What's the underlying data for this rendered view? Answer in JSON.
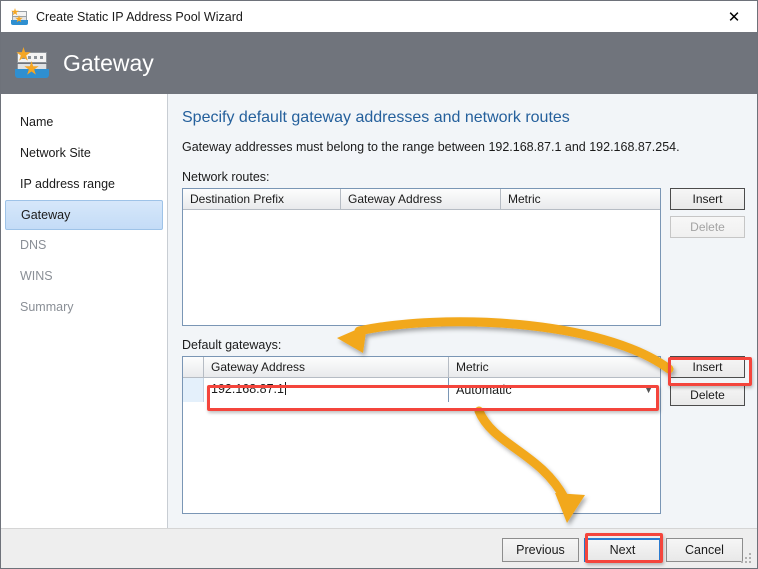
{
  "window": {
    "title": "Create Static IP Address Pool Wizard",
    "title_icon": "ip-pool-icon",
    "close_icon": "✕",
    "header_title": "Gateway",
    "header_bg": "#70747c",
    "accent_blue": "#25609c"
  },
  "sidebar": {
    "items": [
      {
        "label": "Name",
        "state": "normal"
      },
      {
        "label": "Network Site",
        "state": "normal"
      },
      {
        "label": "IP address range",
        "state": "normal"
      },
      {
        "label": "Gateway",
        "state": "selected"
      },
      {
        "label": "DNS",
        "state": "dim"
      },
      {
        "label": "WINS",
        "state": "dim"
      },
      {
        "label": "Summary",
        "state": "dim"
      }
    ]
  },
  "main": {
    "heading": "Specify default gateway addresses and network routes",
    "subtext": "Gateway addresses must belong to the range between 192.168.87.1 and 192.168.87.254.",
    "routes": {
      "label": "Network routes:",
      "columns": [
        "Destination Prefix",
        "Gateway Address",
        "Metric"
      ],
      "rows": [],
      "insert_label": "Insert",
      "delete_label": "Delete",
      "insert_enabled": true,
      "delete_enabled": false
    },
    "gateways": {
      "label": "Default gateways:",
      "columns": [
        "Gateway Address",
        "Metric"
      ],
      "rows": [
        {
          "address": "192.168.87.1",
          "metric": "Automatic",
          "editing": true
        }
      ],
      "metric_options": [
        "Automatic"
      ],
      "dropdown_icon": "chevron-down-icon",
      "insert_label": "Insert",
      "delete_label": "Delete",
      "insert_enabled": true,
      "delete_enabled": true
    }
  },
  "footer": {
    "previous_label": "Previous",
    "next_label": "Next",
    "cancel_label": "Cancel",
    "focused": "Next"
  },
  "annotations": {
    "highlight_color": "#f4453c",
    "arrow_color": "#f2a81d",
    "boxes": [
      "gateway-row",
      "gateways-insert-button",
      "next-button"
    ],
    "arrows": [
      "insert-to-gateway-address",
      "metric-to-next"
    ]
  }
}
